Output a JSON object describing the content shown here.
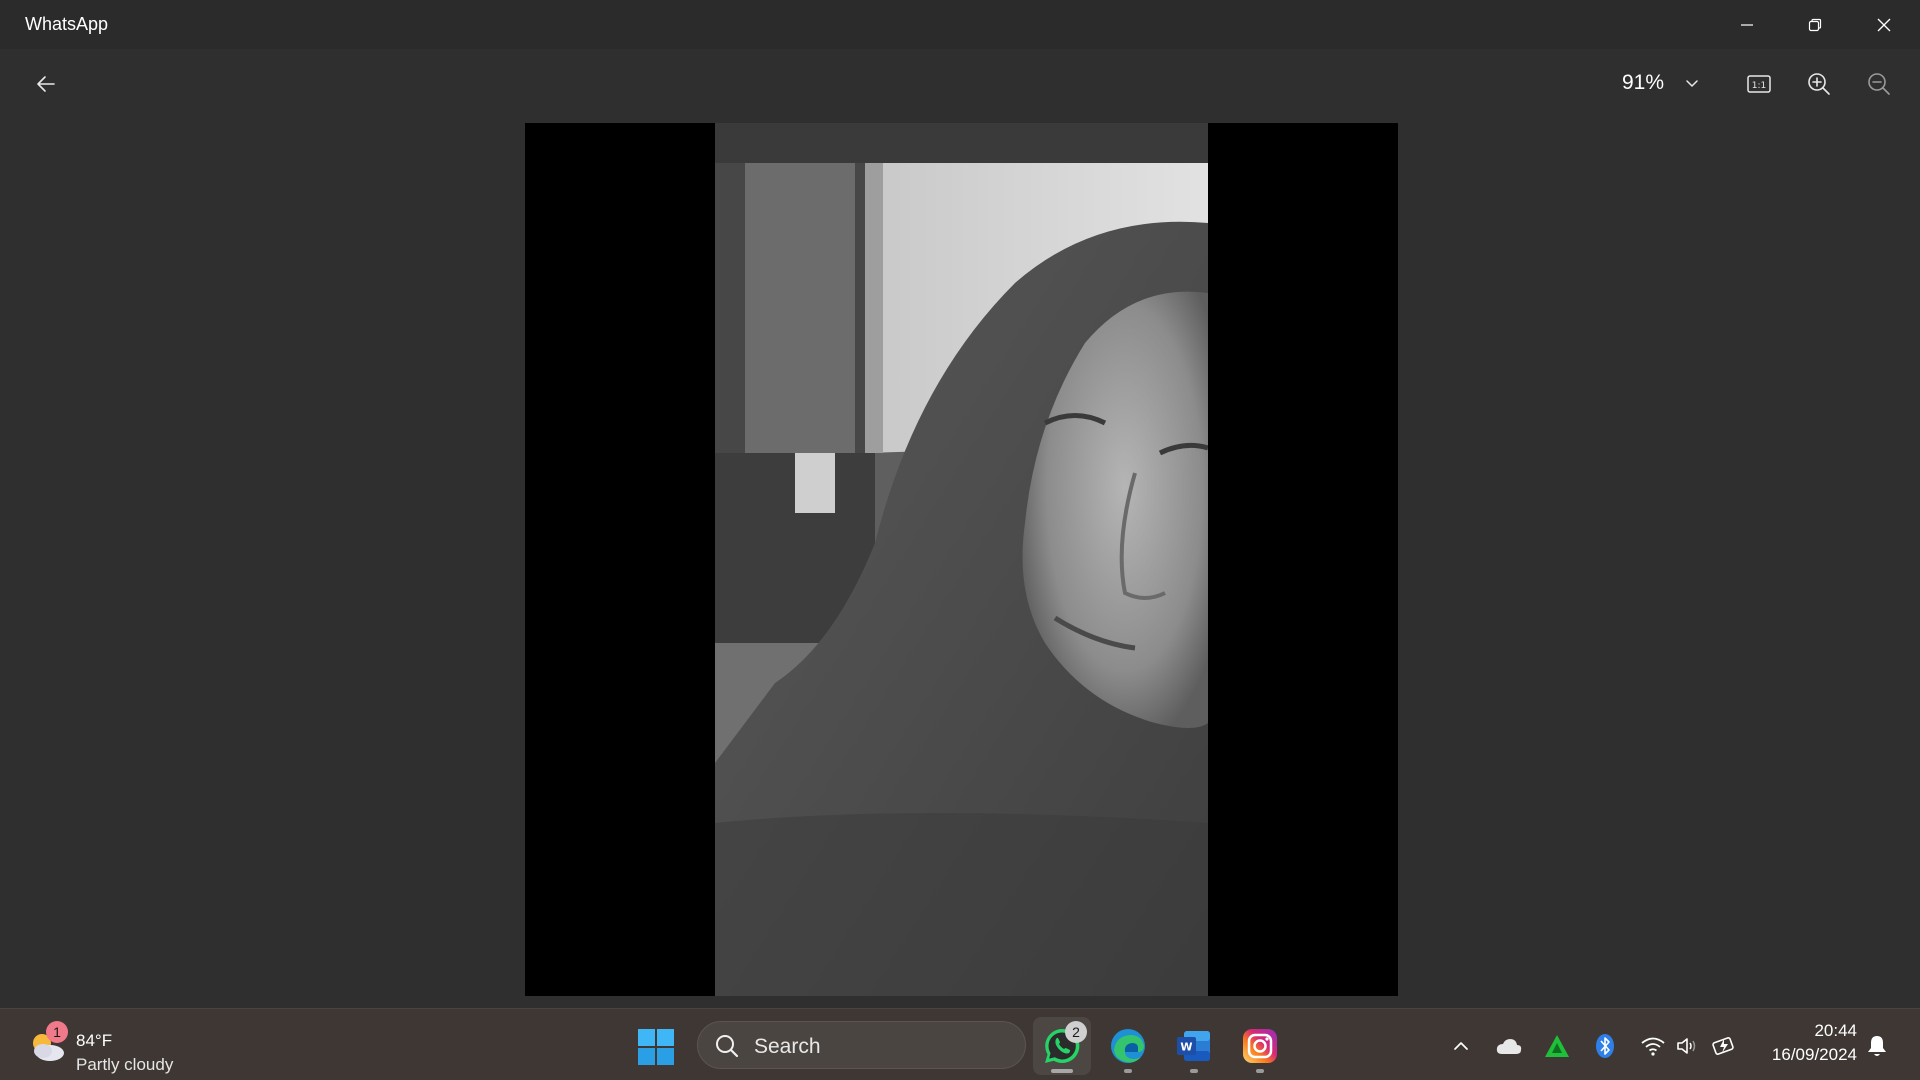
{
  "window": {
    "title": "WhatsApp"
  },
  "viewer": {
    "zoom_label": "91%"
  },
  "taskbar": {
    "weather": {
      "badge": "1",
      "temperature": "84°F",
      "description": "Partly cloudy",
      "icon": "partly-cloudy-icon"
    },
    "search": {
      "label": "Search"
    },
    "apps": [
      {
        "name": "WhatsApp",
        "icon": "whatsapp-icon",
        "badge": "2",
        "active": true
      },
      {
        "name": "Microsoft Edge",
        "icon": "edge-icon",
        "active": false
      },
      {
        "name": "Microsoft Word",
        "icon": "word-icon",
        "active": false
      },
      {
        "name": "Instagram",
        "icon": "instagram-icon",
        "active": false
      }
    ],
    "clock": {
      "time": "20:44",
      "date": "16/09/2024"
    }
  },
  "colors": {
    "titlebar_bg": "#2b2b2b",
    "viewer_bg": "#2f2f2f",
    "taskbar_bg": "#3e3733",
    "whatsapp_green": "#25d366",
    "windows_blue": "#2aa7f0"
  }
}
